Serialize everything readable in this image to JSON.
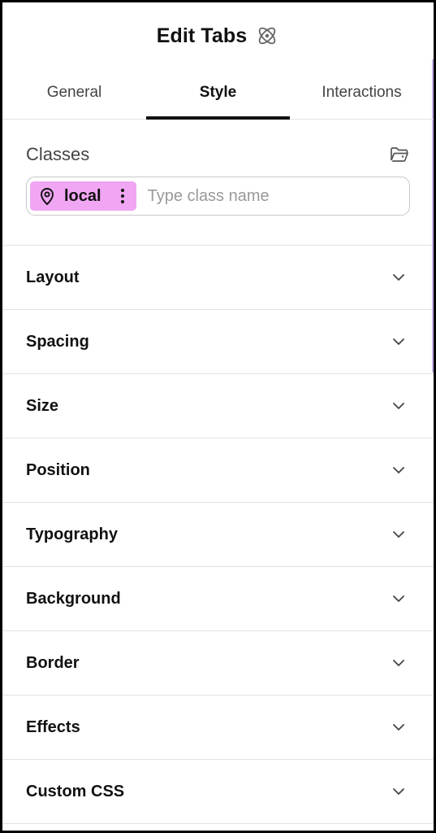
{
  "header": {
    "title": "Edit Tabs",
    "icon": "atom-icon"
  },
  "tabs": [
    {
      "label": "General",
      "active": false
    },
    {
      "label": "Style",
      "active": true
    },
    {
      "label": "Interactions",
      "active": false
    }
  ],
  "classes": {
    "label": "Classes",
    "manage_icon": "folder-icon",
    "chip": {
      "label": "local",
      "icon": "pin-icon",
      "color": "#f0a6f2"
    },
    "input_placeholder": "Type class name"
  },
  "sections": [
    {
      "label": "Layout"
    },
    {
      "label": "Spacing"
    },
    {
      "label": "Size"
    },
    {
      "label": "Position"
    },
    {
      "label": "Typography"
    },
    {
      "label": "Background"
    },
    {
      "label": "Border"
    },
    {
      "label": "Effects"
    },
    {
      "label": "Custom CSS"
    }
  ]
}
